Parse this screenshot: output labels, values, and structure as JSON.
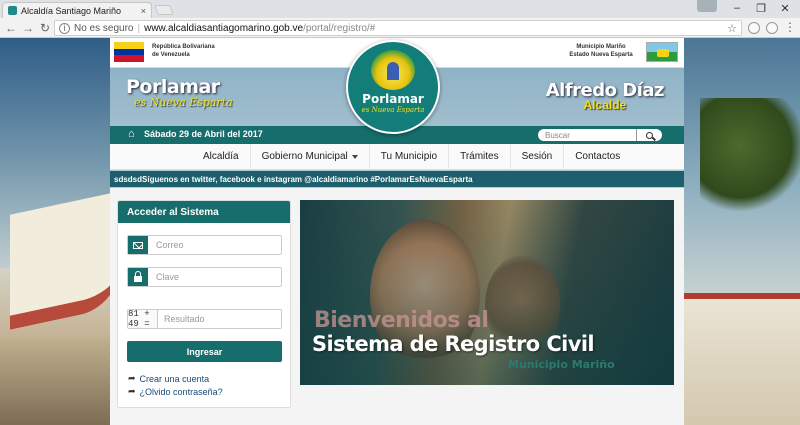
{
  "browser": {
    "tab_title": "Alcaldía Santiago Mariño",
    "tab_close": "×",
    "security_label": "No es seguro",
    "url_domain": "www.alcaldiasantiagomarino.gob.ve",
    "url_path": "/portal/registro/#"
  },
  "header": {
    "gov_line1": "República Bolivariana",
    "gov_line2": "de Venezuela",
    "mun_line1": "Municipio Mariño",
    "mun_line2": "Estado Nueva Esparta",
    "brand_main": "Porlamar",
    "brand_sub": "es Nueva Esparta",
    "logo_main": "Porlamar",
    "logo_sub": "es Nueva Esparta",
    "mayor_name": "Alfredo Díaz",
    "mayor_role": "Alcalde",
    "date": "Sábado 29 de Abril del 2017",
    "search_placeholder": "Buscar"
  },
  "nav": {
    "items": [
      {
        "label": "Alcaldía"
      },
      {
        "label": "Gobierno Municipal"
      },
      {
        "label": "Tu Municipio"
      },
      {
        "label": "Trámites"
      },
      {
        "label": "Sesión"
      },
      {
        "label": "Contactos"
      }
    ]
  },
  "ticker": "sdsdsdSíguenos en twitter, facebook e instagram @alcaldiamarino #PorlamarEsNuevaEsparta",
  "login": {
    "title": "Acceder al Sistema",
    "email_placeholder": "Correo",
    "password_placeholder": "Clave",
    "captcha": "81 + 49 =",
    "captcha_placeholder": "Resultado",
    "submit": "Ingresar",
    "create_account": "Crear una cuenta",
    "forgot_password": "¿Olvido contraseña?"
  },
  "hero": {
    "line1": "Bienvenidos al",
    "line2": "Sistema de Registro Civil",
    "line3": "Municipio Mariño"
  },
  "colors": {
    "primary": "#166e6c",
    "accent_yellow": "#f2e01a"
  }
}
